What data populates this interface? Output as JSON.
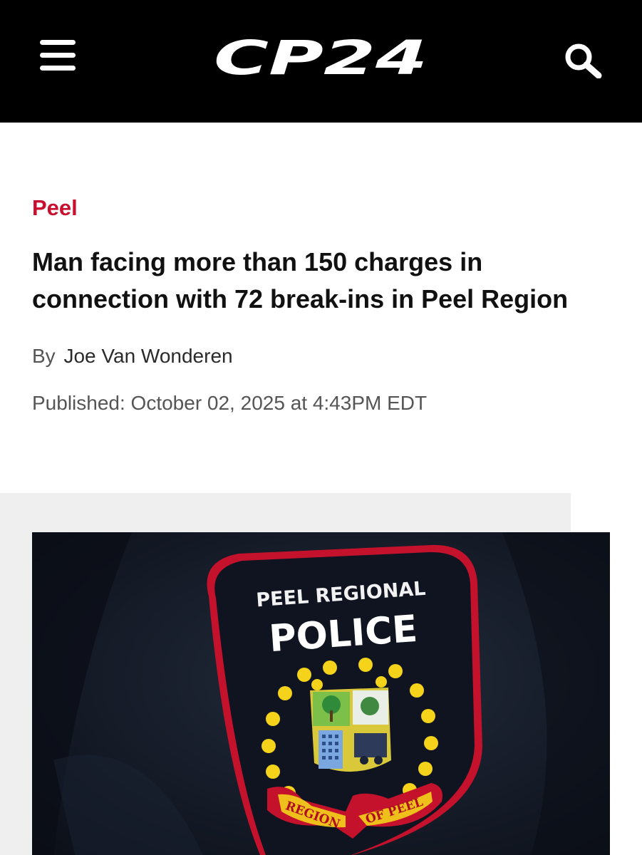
{
  "header": {
    "logo_text": "CP24",
    "menu_icon": "hamburger-menu-icon",
    "search_icon": "search-icon",
    "background": "#000000"
  },
  "article": {
    "category": "Peel",
    "category_color": "#c8102e",
    "headline": "Man facing more than 150 charges in connection with 72 break-ins in Peel Region",
    "byline_prefix": "By",
    "author": "Joe Van Wonderen",
    "published": "Published: October 02, 2025 at 4:43PM EDT"
  },
  "photo": {
    "badge_top_text": "PEEL REGIONAL",
    "badge_main_text": "POLICE",
    "ribbon_left": "REGION",
    "ribbon_right": "OF PEEL"
  }
}
